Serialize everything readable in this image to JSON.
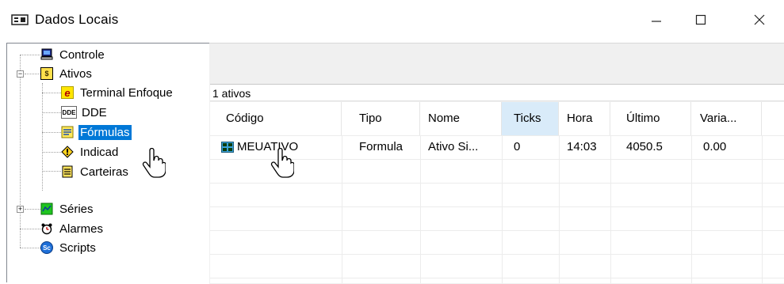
{
  "window": {
    "title": "Dados Locais",
    "minimize_glyph": "—",
    "maximize_glyph": "☐",
    "close_glyph": "✕"
  },
  "tree": {
    "items": [
      {
        "label": "Controle",
        "icon": "computer-icon"
      },
      {
        "label": "Ativos",
        "icon": "dollar-icon"
      },
      {
        "label": "Terminal Enfoque",
        "icon": "enfoque-e-icon"
      },
      {
        "label": "DDE",
        "icon": "dde-icon"
      },
      {
        "label": "Fórmulas",
        "icon": "formula-icon"
      },
      {
        "label": "Indicad",
        "icon": "indicator-diamond-icon"
      },
      {
        "label": "Carteiras",
        "icon": "portfolio-icon"
      },
      {
        "label": "Séries",
        "icon": "series-chart-icon"
      },
      {
        "label": "Alarmes",
        "icon": "alarm-clock-icon"
      },
      {
        "label": "Scripts",
        "icon": "scripts-icon"
      }
    ],
    "expander_minus": "−",
    "expander_plus": "+",
    "dde_icon_text": "DDE",
    "enfoque_icon_text": "e",
    "dollar_icon_text": "$",
    "scripts_icon_text": "Sc"
  },
  "list": {
    "count_text": "1 ativos",
    "columns": [
      "Código",
      "Tipo",
      "Nome",
      "Ticks",
      "Hora",
      "Último",
      "Varia..."
    ],
    "rows": [
      [
        "MEUATIVO",
        "Formula",
        "Ativo Si...",
        "0",
        "14:03",
        "4050.5",
        "0.00"
      ]
    ]
  },
  "colors": {
    "selection": "#0078d7",
    "sorted_column_header": "#d9ebf9"
  }
}
